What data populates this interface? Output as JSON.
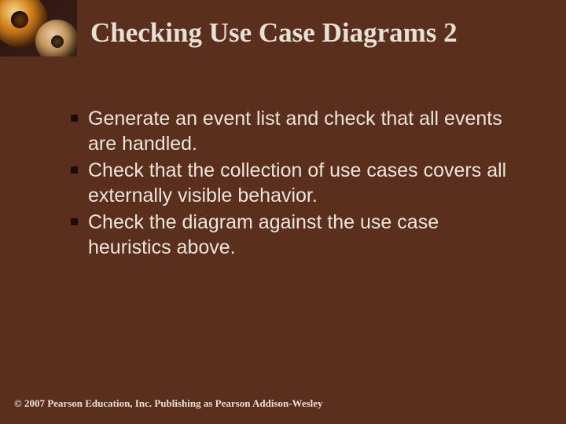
{
  "title": "Checking Use Case Diagrams 2",
  "bullets": {
    "b0": "Generate an event list and check that all events are handled.",
    "b1": "Check that the collection of use cases covers all externally visible behavior.",
    "b2": "Check the diagram against the use case heuristics above."
  },
  "footer": "© 2007 Pearson Education, Inc. Publishing as Pearson Addison-Wesley"
}
